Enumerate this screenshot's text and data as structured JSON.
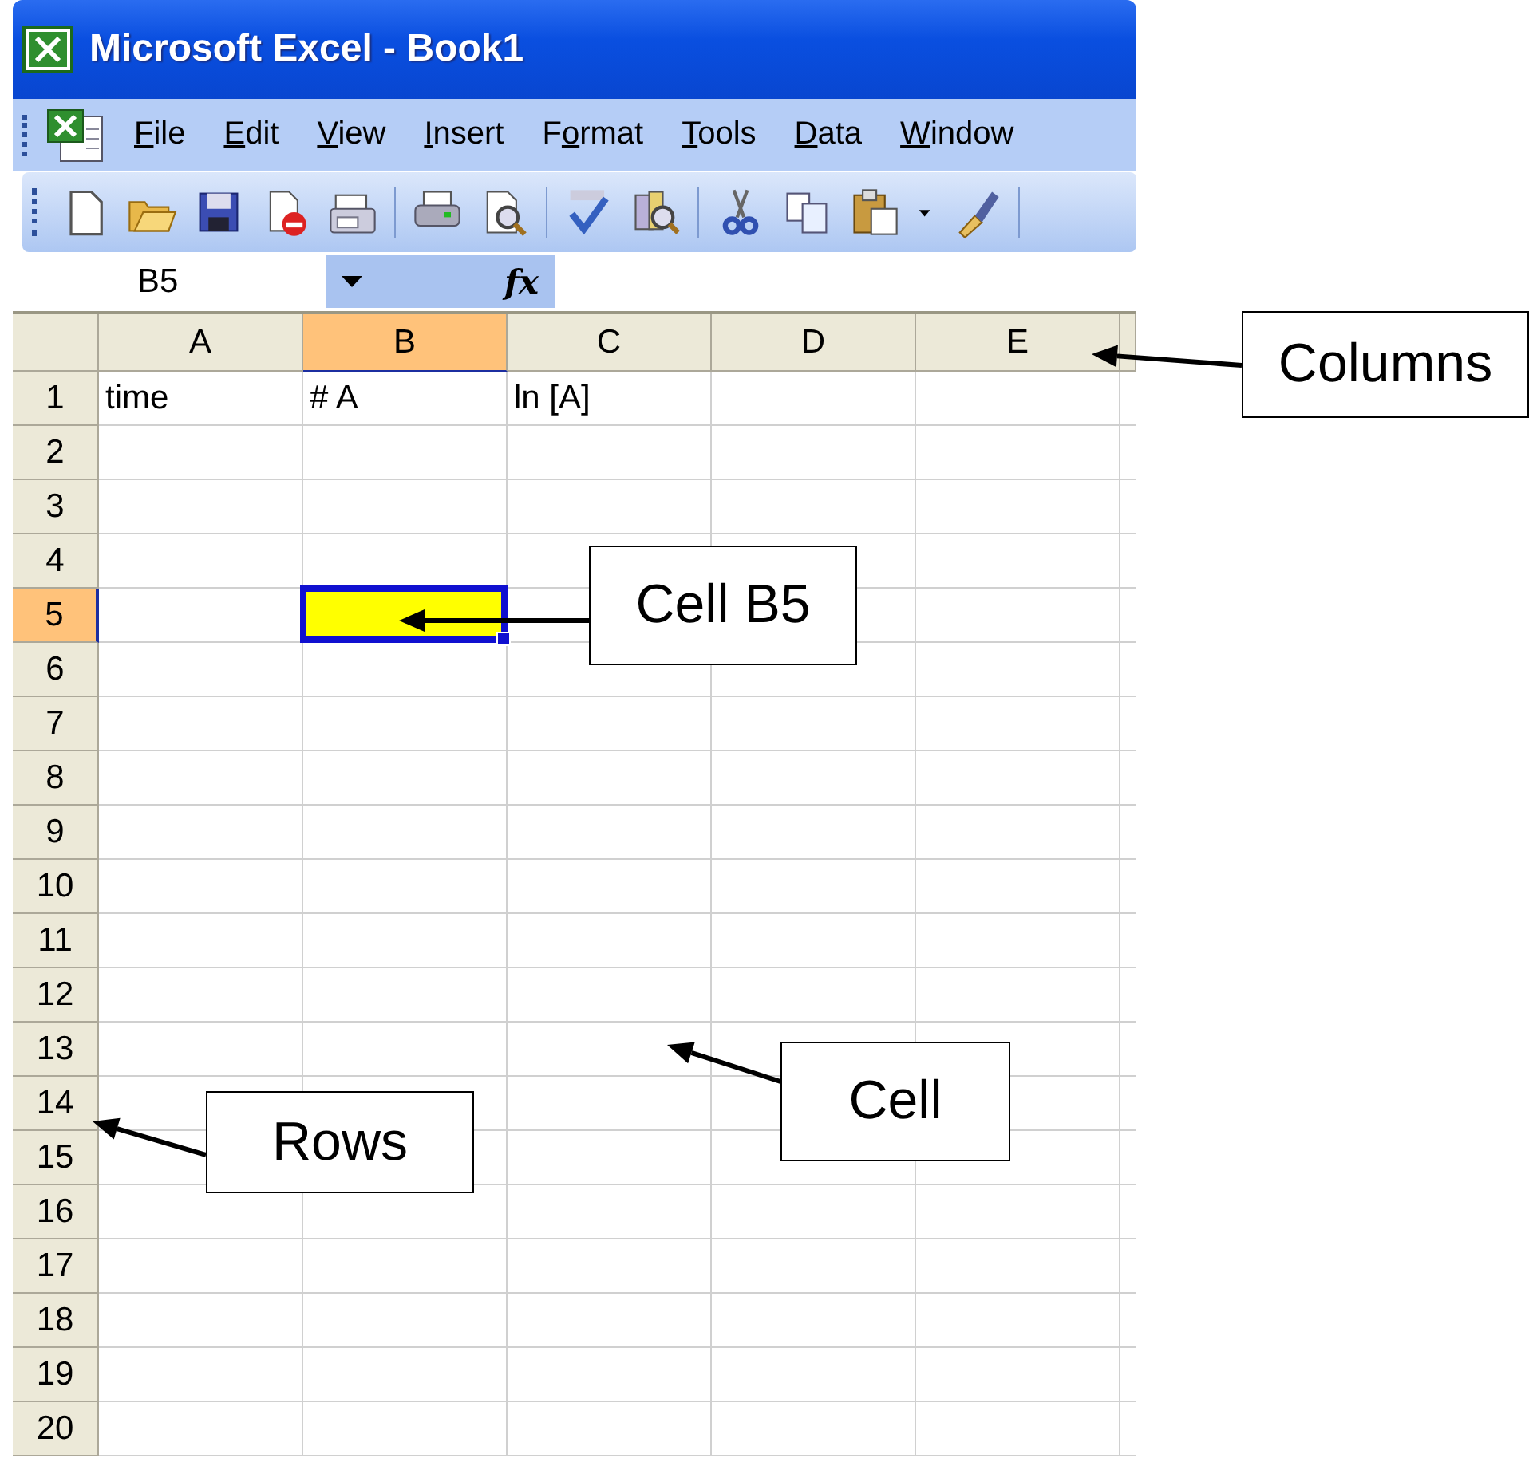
{
  "window": {
    "title": "Microsoft Excel - Book1"
  },
  "menu": [
    {
      "label": "File"
    },
    {
      "label": "Edit"
    },
    {
      "label": "View"
    },
    {
      "label": "Insert"
    },
    {
      "label": "Format"
    },
    {
      "label": "Tools"
    },
    {
      "label": "Data"
    },
    {
      "label": "Window"
    }
  ],
  "formula_bar": {
    "name_box": "B5",
    "fx": "fx"
  },
  "grid": {
    "columns": [
      {
        "label": "A",
        "selected": false
      },
      {
        "label": "B",
        "selected": true
      },
      {
        "label": "C",
        "selected": false
      },
      {
        "label": "D",
        "selected": false
      },
      {
        "label": "E",
        "selected": false
      }
    ],
    "rows": [
      {
        "label": "1",
        "selected": false,
        "cells": [
          "time",
          "# A",
          "ln [A]"
        ]
      },
      {
        "label": "2",
        "selected": false
      },
      {
        "label": "3",
        "selected": false
      },
      {
        "label": "4",
        "selected": false
      },
      {
        "label": "5",
        "selected": true
      },
      {
        "label": "6",
        "selected": false
      },
      {
        "label": "7",
        "selected": false
      },
      {
        "label": "8",
        "selected": false
      },
      {
        "label": "9",
        "selected": false
      },
      {
        "label": "10",
        "selected": false
      },
      {
        "label": "11",
        "selected": false
      },
      {
        "label": "12",
        "selected": false
      },
      {
        "label": "13",
        "selected": false
      },
      {
        "label": "14",
        "selected": false
      },
      {
        "label": "15",
        "selected": false
      },
      {
        "label": "16",
        "selected": false
      },
      {
        "label": "17",
        "selected": false
      },
      {
        "label": "18",
        "selected": false
      },
      {
        "label": "19",
        "selected": false
      },
      {
        "label": "20",
        "selected": false
      }
    ]
  },
  "annotations": [
    {
      "text": "Columns"
    },
    {
      "text": "Cell B5"
    },
    {
      "text": "Cell"
    },
    {
      "text": "Rows"
    }
  ]
}
